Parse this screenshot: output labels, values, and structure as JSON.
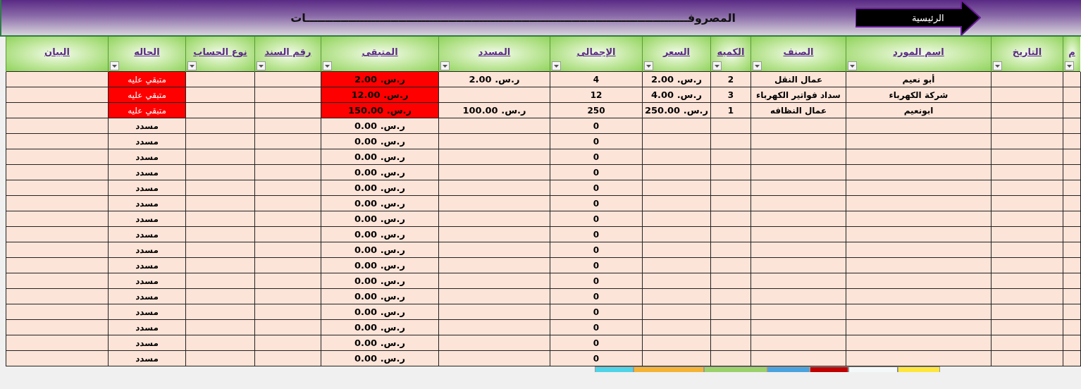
{
  "title": "المصروفـــــــــــــــــــــــــــــــــــــــــــــــــــــــــــــــــــــــــــــــــــــــــــــــــــات",
  "home_button": {
    "label": "الرئيسية"
  },
  "table": {
    "columns": [
      {
        "label": "م",
        "filter": true
      },
      {
        "label": "التاريخ",
        "filter": true
      },
      {
        "label": "اسم المورد",
        "filter": true
      },
      {
        "label": "الصنف",
        "filter": true
      },
      {
        "label": "الكميه",
        "filter": true
      },
      {
        "label": "السعر",
        "filter": true
      },
      {
        "label": "الإجمالى",
        "filter": true
      },
      {
        "label": "المسدد",
        "filter": true
      },
      {
        "label": "المتبقى",
        "filter": true
      },
      {
        "label": "رقم السند",
        "filter": true
      },
      {
        "label": "نوع الحساب",
        "filter": true
      },
      {
        "label": "الحاله",
        "filter": true
      },
      {
        "label": "البيان",
        "filter": false
      }
    ],
    "rows": [
      {
        "outstanding": true,
        "cells": [
          "",
          "",
          "أبو نعيم",
          "عمال النقل",
          "2",
          "ر.س. 2.00",
          "4",
          "ر.س. 2.00",
          "ر.س. 2.00",
          "",
          "",
          "متبقي عليه",
          ""
        ]
      },
      {
        "outstanding": true,
        "cells": [
          "",
          "",
          "شركة الكهرباء",
          "سداد فواتير الكهرباء",
          "3",
          "ر.س. 4.00",
          "12",
          "",
          "ر.س. 12.00",
          "",
          "",
          "متبقي عليه",
          ""
        ]
      },
      {
        "outstanding": true,
        "cells": [
          "",
          "",
          "ابونعيم",
          "عمال النظافه",
          "1",
          "ر.س. 250.00",
          "250",
          "ر.س. 100.00",
          "ر.س. 150.00",
          "",
          "",
          "متبقي عليه",
          ""
        ]
      },
      {
        "outstanding": false,
        "cells": [
          "",
          "",
          "",
          "",
          "",
          "",
          "0",
          "",
          "ر.س. 0.00",
          "",
          "",
          "مسدد",
          ""
        ]
      },
      {
        "outstanding": false,
        "cells": [
          "",
          "",
          "",
          "",
          "",
          "",
          "0",
          "",
          "ر.س. 0.00",
          "",
          "",
          "مسدد",
          ""
        ]
      },
      {
        "outstanding": false,
        "cells": [
          "",
          "",
          "",
          "",
          "",
          "",
          "0",
          "",
          "ر.س. 0.00",
          "",
          "",
          "مسدد",
          ""
        ]
      },
      {
        "outstanding": false,
        "cells": [
          "",
          "",
          "",
          "",
          "",
          "",
          "0",
          "",
          "ر.س. 0.00",
          "",
          "",
          "مسدد",
          ""
        ]
      },
      {
        "outstanding": false,
        "cells": [
          "",
          "",
          "",
          "",
          "",
          "",
          "0",
          "",
          "ر.س. 0.00",
          "",
          "",
          "مسدد",
          ""
        ]
      },
      {
        "outstanding": false,
        "cells": [
          "",
          "",
          "",
          "",
          "",
          "",
          "0",
          "",
          "ر.س. 0.00",
          "",
          "",
          "مسدد",
          ""
        ]
      },
      {
        "outstanding": false,
        "cells": [
          "",
          "",
          "",
          "",
          "",
          "",
          "0",
          "",
          "ر.س. 0.00",
          "",
          "",
          "مسدد",
          ""
        ]
      },
      {
        "outstanding": false,
        "cells": [
          "",
          "",
          "",
          "",
          "",
          "",
          "0",
          "",
          "ر.س. 0.00",
          "",
          "",
          "مسدد",
          ""
        ]
      },
      {
        "outstanding": false,
        "cells": [
          "",
          "",
          "",
          "",
          "",
          "",
          "0",
          "",
          "ر.س. 0.00",
          "",
          "",
          "مسدد",
          ""
        ]
      },
      {
        "outstanding": false,
        "cells": [
          "",
          "",
          "",
          "",
          "",
          "",
          "0",
          "",
          "ر.س. 0.00",
          "",
          "",
          "مسدد",
          ""
        ]
      },
      {
        "outstanding": false,
        "cells": [
          "",
          "",
          "",
          "",
          "",
          "",
          "0",
          "",
          "ر.س. 0.00",
          "",
          "",
          "مسدد",
          ""
        ]
      },
      {
        "outstanding": false,
        "cells": [
          "",
          "",
          "",
          "",
          "",
          "",
          "0",
          "",
          "ر.س. 0.00",
          "",
          "",
          "مسدد",
          ""
        ]
      },
      {
        "outstanding": false,
        "cells": [
          "",
          "",
          "",
          "",
          "",
          "",
          "0",
          "",
          "ر.س. 0.00",
          "",
          "",
          "مسدد",
          ""
        ]
      },
      {
        "outstanding": false,
        "cells": [
          "",
          "",
          "",
          "",
          "",
          "",
          "0",
          "",
          "ر.س. 0.00",
          "",
          "",
          "مسدد",
          ""
        ]
      },
      {
        "outstanding": false,
        "cells": [
          "",
          "",
          "",
          "",
          "",
          "",
          "0",
          "",
          "ر.س. 0.00",
          "",
          "",
          "مسدد",
          ""
        ]
      },
      {
        "outstanding": false,
        "cells": [
          "",
          "",
          "",
          "",
          "",
          "",
          "0",
          "",
          "ر.س. 0.00",
          "",
          "",
          "مسدد",
          ""
        ]
      }
    ]
  },
  "sheet_tabs": [
    {
      "color": "#ffe63c"
    },
    {
      "color": "#f4f8f8",
      "selected": true
    },
    {
      "color": "#c00000"
    },
    {
      "color": "#4aa3df"
    },
    {
      "color": "#9bd16a"
    },
    {
      "color": "#f5b335"
    },
    {
      "color": "#4fd3e6"
    }
  ]
}
